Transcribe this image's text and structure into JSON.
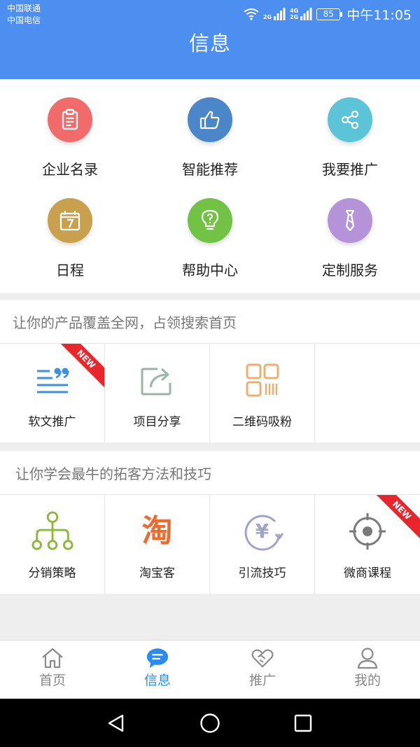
{
  "status_bar": {
    "carrier_1": "中国联通",
    "carrier_2": "中国电信",
    "net_1": "2G",
    "net_2_top": "4G",
    "net_2_bottom": "2G",
    "battery": "85",
    "time": "中午11:05"
  },
  "header": {
    "title": "信息"
  },
  "features": [
    {
      "label": "企业名录",
      "icon": "clipboard-icon",
      "color": "#f26b6b"
    },
    {
      "label": "智能推荐",
      "icon": "thumbs-up-icon",
      "color": "#4a86c8"
    },
    {
      "label": "我要推广",
      "icon": "share-icon",
      "color": "#5bc4d6"
    },
    {
      "label": "日程",
      "icon": "calendar-icon",
      "color": "#c9a04e"
    },
    {
      "label": "帮助中心",
      "icon": "lightbulb-icon",
      "color": "#71c245"
    },
    {
      "label": "定制服务",
      "icon": "necktie-icon",
      "color": "#b493d8"
    }
  ],
  "section1": {
    "title": "让你的产品覆盖全网，占领搜索首页",
    "tiles": [
      {
        "label": "软文推广",
        "icon": "article-quote-icon",
        "badge": "NEW"
      },
      {
        "label": "项目分享",
        "icon": "share-box-icon"
      },
      {
        "label": "二维码吸粉",
        "icon": "qr-code-icon"
      }
    ]
  },
  "section2": {
    "title": "让你学会最牛的拓客方法和技巧",
    "tiles": [
      {
        "label": "分销策略",
        "icon": "distribution-tree-icon"
      },
      {
        "label": "淘宝客",
        "icon": "taobao-icon",
        "glyph": "淘"
      },
      {
        "label": "引流技巧",
        "icon": "yuan-cycle-icon",
        "glyph": "¥"
      },
      {
        "label": "微商课程",
        "icon": "target-icon",
        "badge": "NEW"
      }
    ]
  },
  "bottom_nav": [
    {
      "label": "首页",
      "icon": "home-icon"
    },
    {
      "label": "信息",
      "icon": "message-icon",
      "active": true
    },
    {
      "label": "推广",
      "icon": "heart-handshake-icon"
    },
    {
      "label": "我的",
      "icon": "user-icon"
    }
  ],
  "colors": {
    "header_blue": "#4d8ff0",
    "active_nav": "#2a8cef",
    "badge_red": "#e8262b"
  }
}
